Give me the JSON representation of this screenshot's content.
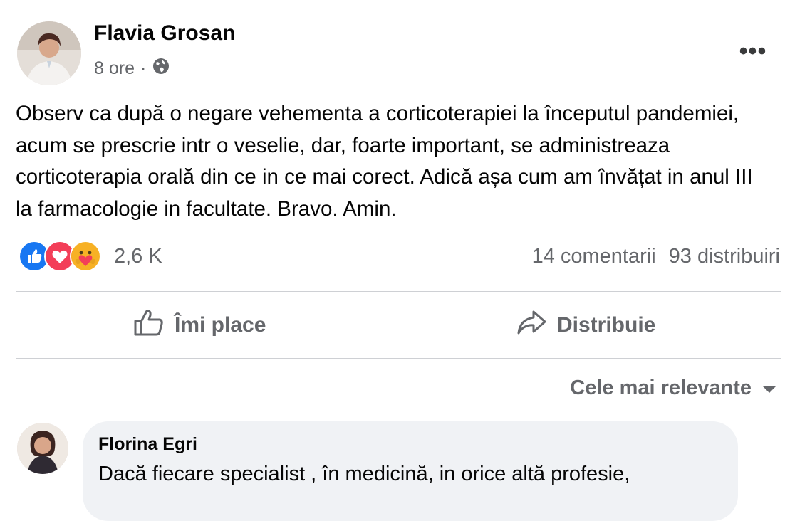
{
  "post": {
    "author": "Flavia Grosan",
    "time": "8 ore",
    "separator": "·",
    "privacy_icon": "globe-icon",
    "more_label": "•••",
    "text": "Observ ca după o negare vehementa a corticoterapiei la începutul pandemiei, acum se prescrie intr o veselie, dar, foarte important, se administreaza corticoterapia orală din ce in ce mai corect. Adică așa cum am învățat in anul III la farmacologie in facultate. Bravo. Amin."
  },
  "reactions": {
    "icons": [
      "like-reaction-icon",
      "love-reaction-icon",
      "care-reaction-icon"
    ],
    "count": "2,6 K"
  },
  "stats": {
    "comments": "14 comentarii",
    "shares": "93 distribuiri"
  },
  "actions": {
    "like_label": "Îmi place",
    "share_label": "Distribuie"
  },
  "comments": {
    "sort_label": "Cele mai relevante",
    "items": [
      {
        "author": "Florina Egri",
        "text": "Dacă fiecare specialist , în medicină, in orice altă profesie,"
      }
    ]
  },
  "colors": {
    "primary_text": "#050505",
    "secondary_text": "#65676b",
    "like_blue": "#1877f2",
    "love_red": "#f33e58",
    "care_yellow": "#f7b125",
    "divider": "#ced0d4",
    "comment_bubble": "#f0f2f5"
  }
}
